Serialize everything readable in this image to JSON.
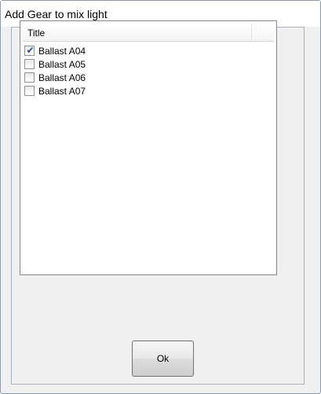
{
  "window": {
    "title": "Add Gear to mix light"
  },
  "list": {
    "columns": [
      "Title",
      ""
    ],
    "items": [
      {
        "label": "Ballast A04",
        "checked": true
      },
      {
        "label": "Ballast A05",
        "checked": false
      },
      {
        "label": "Ballast A06",
        "checked": false
      },
      {
        "label": "Ballast A07",
        "checked": false
      }
    ]
  },
  "buttons": {
    "ok_label": "Ok"
  },
  "colors": {
    "checkmark": "#2a4f8f",
    "window_border": "#8e9aa6",
    "client_bg": "#f0f0f0"
  },
  "icons": {
    "checkmark": "check-icon"
  }
}
